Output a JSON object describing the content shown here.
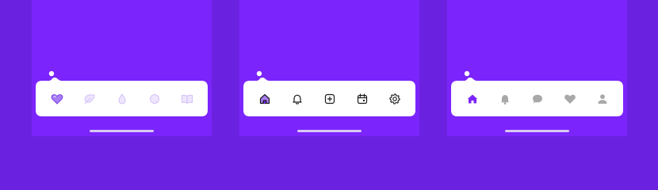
{
  "colors": {
    "background": "#6b22e0",
    "screen": "#7b24fb",
    "tabbar": "#ffffff",
    "indicator": "#d8c9f4",
    "accent": "#7b24fb"
  },
  "screens": [
    {
      "id": "pastel-style",
      "tabs": [
        {
          "icon": "heart-icon",
          "active": true
        },
        {
          "icon": "leaf-icon",
          "active": false
        },
        {
          "icon": "drop-icon",
          "active": false
        },
        {
          "icon": "circle-icon",
          "active": false
        },
        {
          "icon": "book-icon",
          "active": false
        }
      ]
    },
    {
      "id": "outline-style",
      "tabs": [
        {
          "icon": "home-icon",
          "active": true
        },
        {
          "icon": "bell-icon",
          "active": false
        },
        {
          "icon": "add-square-icon",
          "active": false
        },
        {
          "icon": "calendar-icon",
          "active": false
        },
        {
          "icon": "gear-icon",
          "active": false
        }
      ]
    },
    {
      "id": "filled-style",
      "tabs": [
        {
          "icon": "home-icon",
          "active": true
        },
        {
          "icon": "bell-icon",
          "active": false
        },
        {
          "icon": "chat-bubble-icon",
          "active": false
        },
        {
          "icon": "heart-icon",
          "active": false
        },
        {
          "icon": "user-icon",
          "active": false
        }
      ]
    }
  ]
}
